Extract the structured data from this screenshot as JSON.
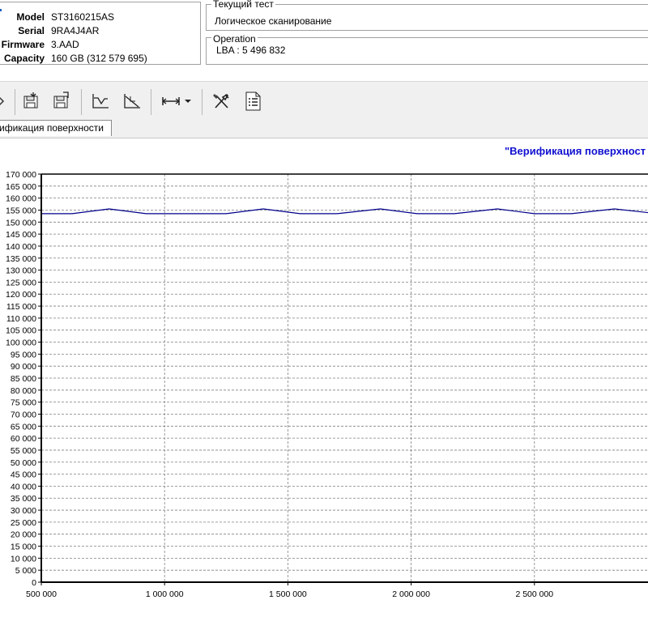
{
  "drive": {
    "model_label": "Model",
    "model_value": "ST3160215AS",
    "serial_label": "Serial",
    "serial_value": "9RA4J4AR",
    "firmware_label": "Firmware",
    "firmware_value": "3.AAD",
    "capacity_label": "Capacity",
    "capacity_value": "160 GB (312 579 695)"
  },
  "current_test": {
    "title": "Текущий тест",
    "value": "Логическое сканирование"
  },
  "operation": {
    "title": "Operation",
    "value": "LBA : 5 496 832"
  },
  "toolbar": {
    "icons": [
      "drive-save-icon",
      "drive-load-icon",
      "graph-valley-icon",
      "graph-slope-icon",
      "range-arrows-icon",
      "dropdown-arrow-icon",
      "tools-icon",
      "report-icon"
    ]
  },
  "tab": {
    "label": "ификация поверхности"
  },
  "chart_title": "\"Верификация поверхност",
  "chart_data": {
    "type": "line",
    "title": "\"Верификация поверхност",
    "xlim": [
      500000,
      3000000
    ],
    "ylim": [
      0,
      170000
    ],
    "x_ticks": [
      "500 000",
      "1 000 000",
      "1 500 000",
      "2 000 000",
      "2 500 000",
      "3 0"
    ],
    "y_ticks": [
      "170 000",
      "165 000",
      "160 000",
      "155 000",
      "150 000",
      "145 000",
      "140 000",
      "135 000",
      "130 000",
      "125 000",
      "120 000",
      "115 000",
      "110 000",
      "105 000",
      "100 000",
      "95 000",
      "90 000",
      "85 000",
      "80 000",
      "75 000",
      "70 000",
      "65 000",
      "60 000",
      "55 000",
      "50 000",
      "45 000",
      "40 000",
      "35 000",
      "30 000",
      "25 000",
      "20 000",
      "15 000",
      "10 000",
      "5 000",
      "0"
    ],
    "grid": true,
    "line_color": "#00008b",
    "series": [
      {
        "x": [
          500000,
          625000,
          775000,
          925000,
          1075000,
          1250000,
          1400000,
          1550000,
          1700000,
          1875000,
          2025000,
          2175000,
          2350000,
          2500000,
          2650000,
          2825000,
          3000000
        ],
        "y": [
          153500,
          153500,
          155500,
          153500,
          153500,
          153500,
          155500,
          153500,
          153500,
          155500,
          153500,
          153500,
          155500,
          153500,
          153500,
          155500,
          153500
        ]
      }
    ]
  }
}
